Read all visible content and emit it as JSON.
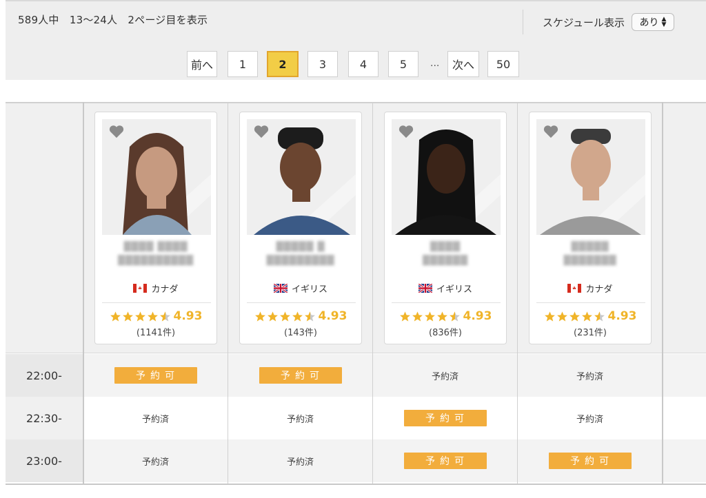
{
  "header": {
    "summary": "589人中　13〜24人　2ページ目を表示",
    "schedule_label": "スケジュール表示",
    "schedule_value": "あり"
  },
  "pagination": {
    "prev": "前へ",
    "pages": [
      "1",
      "2",
      "3",
      "4",
      "5"
    ],
    "current": "2",
    "ellipsis": "...",
    "next": "次へ",
    "last": "50"
  },
  "teachers": [
    {
      "country": "カナダ",
      "flag": "canada-flag-icon",
      "rating": "4.93",
      "reviews": "(1141件)"
    },
    {
      "country": "イギリス",
      "flag": "uk-flag-icon",
      "rating": "4.93",
      "reviews": "(143件)"
    },
    {
      "country": "イギリス",
      "flag": "uk-flag-icon",
      "rating": "4.93",
      "reviews": "(836件)"
    },
    {
      "country": "カナダ",
      "flag": "canada-flag-icon",
      "rating": "4.93",
      "reviews": "(231件)"
    }
  ],
  "schedule": {
    "available_label": "予約可",
    "booked_label": "予約済",
    "slots": [
      {
        "time": "22:00-",
        "status": [
          "予約可",
          "予約可",
          "予約済",
          "予約済"
        ]
      },
      {
        "time": "22:30-",
        "status": [
          "予約済",
          "予約済",
          "予約可",
          "予約済"
        ]
      },
      {
        "time": "23:00-",
        "status": [
          "予約済",
          "予約済",
          "予約可",
          "予約可"
        ]
      }
    ]
  },
  "colors": {
    "accent": "#f2ad3c",
    "star": "#f0b429",
    "active_page": "#f2cd46"
  }
}
